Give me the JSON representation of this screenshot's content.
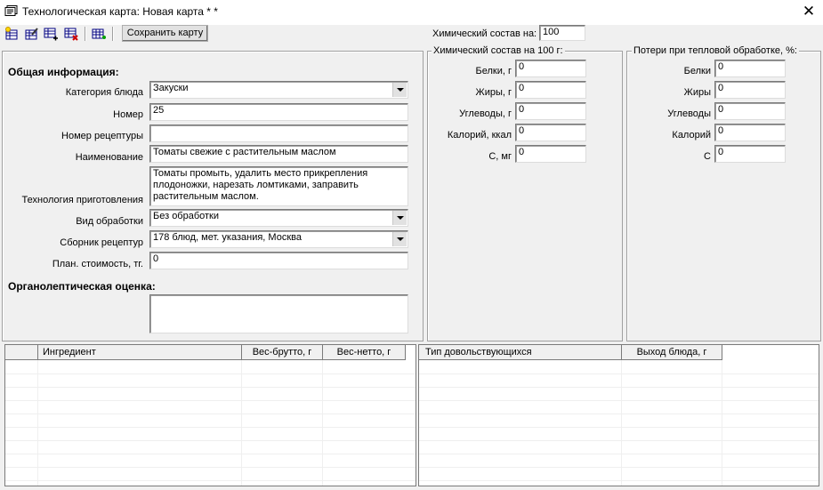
{
  "window": {
    "title": "Технологическая карта: Новая карта * *",
    "close_glyph": "✕"
  },
  "toolbar": {
    "save_label": "Сохранить карту",
    "icons": [
      "new-card-icon",
      "edit-card-icon",
      "add-row-icon",
      "delete-row-icon",
      "grid-settings-icon"
    ]
  },
  "chem_basis": {
    "label": "Химический состав на:",
    "value": "100"
  },
  "general": {
    "heading": "Общая информация:",
    "category_label": "Категория блюда",
    "category_value": "Закуски",
    "number_label": "Номер",
    "number_value": "25",
    "recipe_number_label": "Номер рецептуры",
    "recipe_number_value": "",
    "name_label": "Наименование",
    "name_value": "Томаты свежие с растительным маслом",
    "tech_label": "Технология приготовления",
    "tech_value": "Томаты промыть, удалить место прикрепления плодоножки, нарезать ломтиками, заправить растительным маслом.",
    "processing_label": "Вид обработки",
    "processing_value": "Без обработки",
    "collection_label": "Сборник рецептур",
    "collection_value": "178 блюд, мет. указания, Москва",
    "cost_label": "План. стоимость, тг.",
    "cost_value": "0",
    "organoleptic_heading": "Органолептическая оценка:",
    "organoleptic_value": ""
  },
  "chem": {
    "title": "Химический состав на 100 г:",
    "rows": [
      {
        "label": "Белки, г",
        "value": "0"
      },
      {
        "label": "Жиры, г",
        "value": "0"
      },
      {
        "label": "Углеводы, г",
        "value": "0"
      },
      {
        "label": "Калорий, ккал",
        "value": "0"
      },
      {
        "label": "С, мг",
        "value": "0"
      }
    ]
  },
  "losses": {
    "title": "Потери при тепловой обработке, %:",
    "rows": [
      {
        "label": "Белки",
        "value": "0"
      },
      {
        "label": "Жиры",
        "value": "0"
      },
      {
        "label": "Углеводы",
        "value": "0"
      },
      {
        "label": "Калорий",
        "value": "0"
      },
      {
        "label": "С",
        "value": "0"
      }
    ]
  },
  "ingredients_grid": {
    "columns": [
      "",
      "Ингредиент",
      "Вес-брутто, г",
      "Вес-нетто, г"
    ]
  },
  "output_grid": {
    "columns": [
      "Тип довольствующихся",
      "Выход блюда, г"
    ]
  }
}
